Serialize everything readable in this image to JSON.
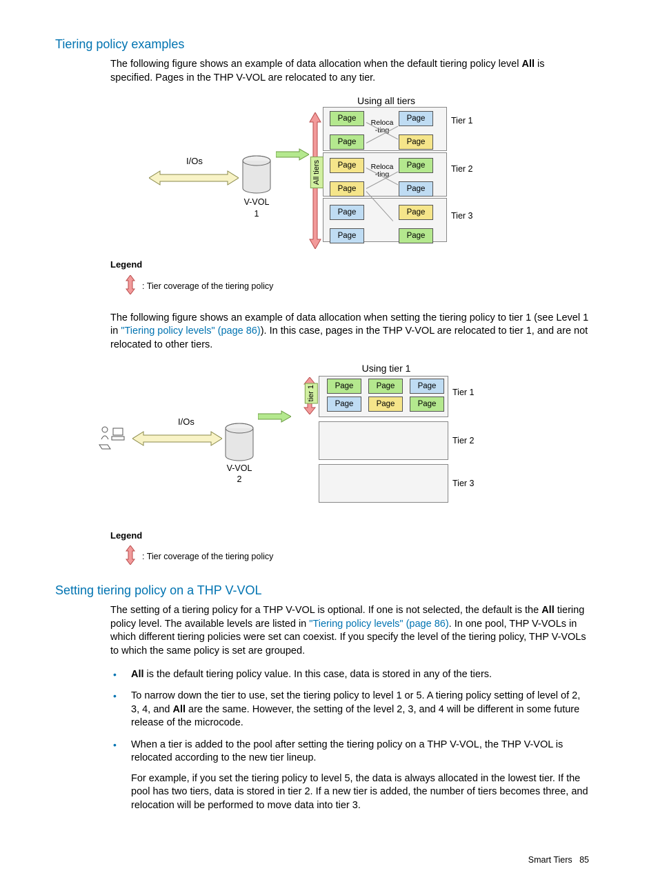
{
  "heading1": "Tiering policy examples",
  "para1a": "The following figure shows an example of data allocation when the default tiering policy level ",
  "para1b": "All",
  "para1c": " is specified. Pages in the THP V-VOL are relocated to any tier.",
  "dia1": {
    "title": "Using all tiers",
    "vvol": "V-VOL\n1",
    "ios": "I/Os",
    "vertLabel": "All tiers",
    "reloc": "Reloca\n-ting",
    "page": "Page",
    "tiers": [
      "Tier 1",
      "Tier 2",
      "Tier 3"
    ]
  },
  "legend": {
    "title": "Legend",
    "text": ": Tier coverage of the tiering policy"
  },
  "para2a": "The following figure shows an example of data allocation when setting the tiering policy to tier 1 (see Level 1 in ",
  "para2link": "\"Tiering policy levels\" (page 86)",
  "para2b": "). In this case, pages in the THP V-VOL are relocated to tier 1, and are not relocated to other tiers.",
  "dia2": {
    "title": "Using tier 1",
    "vvol": "V-VOL\n2",
    "ios": "I/Os",
    "vertLabel": "tier 1",
    "page": "Page",
    "tiers": [
      "Tier 1",
      "Tier 2",
      "Tier 3"
    ]
  },
  "heading2": "Setting tiering policy on a THP V-VOL",
  "para3a": "The setting of a tiering policy for a THP V-VOL is optional. If one is not selected, the default is the ",
  "para3b": "All",
  "para3c": " tiering policy level. The available levels are listed in ",
  "para3link": "\"Tiering policy levels\" (page 86)",
  "para3d": ". In one pool, THP V-VOLs in which different tiering policies were set can coexist. If you specify the level of the tiering policy, THP V-VOLs to which the same policy is set are grouped.",
  "bullet1a": "All",
  "bullet1b": " is the default tiering policy value. In this case, data is stored in any of the tiers.",
  "bullet2a": "To narrow down the tier to use, set the tiering policy to level 1 or 5. A tiering policy setting of level of 2, 3, 4, and ",
  "bullet2b": "All",
  "bullet2c": " are the same. However, the setting of the level 2, 3, and 4 will be different in some future release of the microcode.",
  "bullet3": "When a tier is added to the pool after setting the tiering policy on a THP V-VOL, the THP V-VOL is relocated according to the new tier lineup.",
  "bullet3extra": "For example, if you set the tiering policy to level 5, the data is always allocated in the lowest tier. If the pool has two tiers, data is stored in tier 2. If a new tier is added, the number of tiers becomes three, and relocation will be performed to move data into tier 3.",
  "footer": "Smart Tiers",
  "pageNum": "85"
}
